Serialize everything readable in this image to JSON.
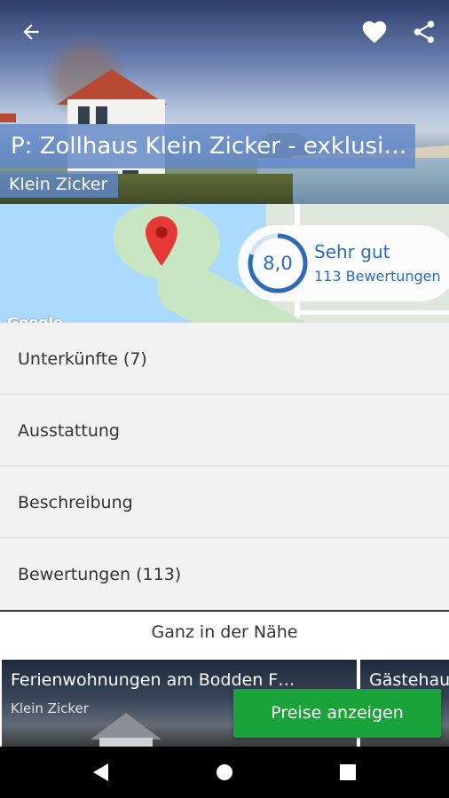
{
  "hero": {
    "title": "P: Zollhaus Klein Zicker - exklusi…",
    "location": "Klein Zicker"
  },
  "icons": {
    "back": "arrow-left-icon",
    "favorite": "heart-icon",
    "share": "share-icon",
    "map_pin": "map-pin-icon"
  },
  "map": {
    "provider_label": "Google"
  },
  "rating": {
    "score": "8,0",
    "score_fraction": 0.8,
    "label": "Sehr gut",
    "count": "113 Bewertungen"
  },
  "menu": [
    {
      "label": "Unterkünfte (7)"
    },
    {
      "label": "Ausstattung"
    },
    {
      "label": "Beschreibung"
    },
    {
      "label": "Bewertungen (113)"
    }
  ],
  "nearby": {
    "title": "Ganz in der Nähe",
    "cards": [
      {
        "name": "Ferienwohnungen am Bodden F…",
        "location": "Klein Zicker"
      },
      {
        "name": "Gästehau",
        "location": ""
      }
    ]
  },
  "cta": {
    "label": "Preise anzeigen"
  },
  "colors": {
    "accent": "#2e6bb6",
    "cta": "#1aa33b",
    "title_overlay": "#6088c8"
  }
}
